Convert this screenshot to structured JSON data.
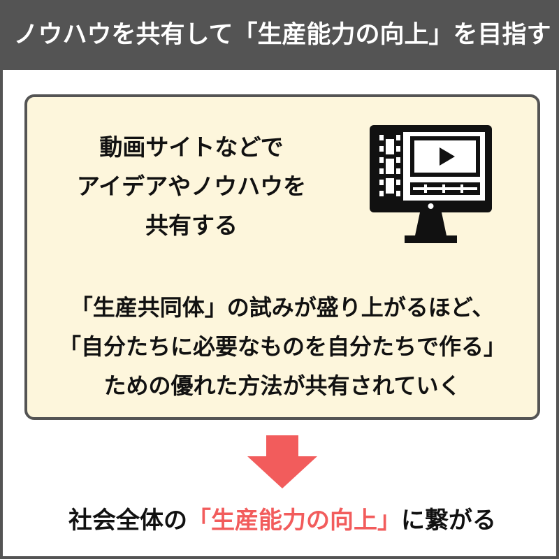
{
  "header": {
    "title": "ノウハウを共有して「生産能力の向上」を目指す"
  },
  "panel": {
    "top_lines": [
      "動画サイトなどで",
      "アイデアやノウハウを",
      "共有する"
    ],
    "icon": "video-monitor-icon",
    "bottom_lines": [
      "「生産共同体」の試みが盛り上がるほど、",
      "「自分たちに必要なものを自分たちで作る」",
      "ための優れた方法が共有されていく"
    ]
  },
  "arrow": {
    "icon": "down-arrow-icon"
  },
  "footer": {
    "prefix": "社会全体の",
    "highlight": "「生産能力の向上」",
    "suffix": "に繋がる"
  },
  "colors": {
    "header_bg": "#545454",
    "panel_bg": "#fdf6dc",
    "accent": "#f25c5c",
    "text": "#111111"
  }
}
